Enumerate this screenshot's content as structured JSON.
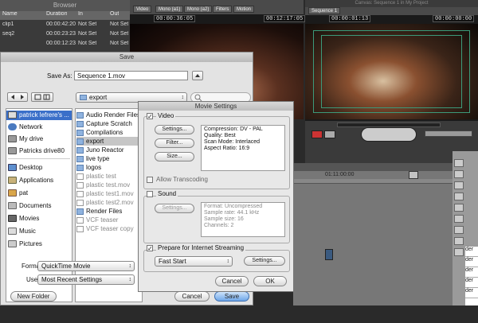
{
  "browser": {
    "title": "Browser",
    "columns": [
      "Name",
      "Duration",
      "In",
      "Out"
    ],
    "rows": [
      {
        "name": "clip1",
        "duration": "00:00:42:20",
        "in": "Not Set",
        "out": "Not Set"
      },
      {
        "name": "seq2",
        "duration": "00:00:23:23",
        "in": "Not Set",
        "out": "Not Set"
      },
      {
        "name": "",
        "duration": "00:00:12:23",
        "in": "Not Set",
        "out": "Not Set"
      }
    ]
  },
  "viewer": {
    "tabs": [
      "Video",
      "Mono (a1)",
      "Mono (a2)",
      "Filters",
      "Motion"
    ],
    "timecode_left": "00:00:36:05",
    "timecode_right": "00:12:17:05"
  },
  "canvas": {
    "title": "Canvas: Sequence 1 in My Project",
    "tab": "Sequence 1",
    "timecode_left": "00:00:01:13",
    "timecode_right": "00:00:00:00"
  },
  "timeline": {
    "ruler_time": "01:11:00:00",
    "track_labels": [
      "der",
      "der",
      "der",
      "der",
      "der"
    ]
  },
  "save_dialog": {
    "title": "Save",
    "save_as_label": "Save As:",
    "filename": "Sequence 1.mov",
    "location": "export",
    "sidebar": [
      {
        "label": "patrick lefrere's ...",
        "icon": "computer-icon",
        "selected": true
      },
      {
        "label": "Network",
        "icon": "globe-icon"
      },
      {
        "label": "My drive",
        "icon": "drive-icon"
      },
      {
        "label": "Patricks drive80",
        "icon": "drive-icon"
      },
      {
        "label": "Desktop",
        "icon": "desktop-icon"
      },
      {
        "label": "Applications",
        "icon": "applications-icon"
      },
      {
        "label": "pat",
        "icon": "home-icon"
      },
      {
        "label": "Documents",
        "icon": "folder-icon"
      },
      {
        "label": "Movies",
        "icon": "folder-icon"
      },
      {
        "label": "Music",
        "icon": "folder-icon"
      },
      {
        "label": "Pictures",
        "icon": "folder-icon"
      }
    ],
    "files": [
      {
        "label": "Audio Render Files",
        "type": "folder"
      },
      {
        "label": "Capture Scratch",
        "type": "folder"
      },
      {
        "label": "Compilations",
        "type": "folder"
      },
      {
        "label": "export",
        "type": "folder",
        "selected": true
      },
      {
        "label": "Juno Reactor",
        "type": "folder"
      },
      {
        "label": "live type",
        "type": "folder"
      },
      {
        "label": "logos",
        "type": "folder"
      },
      {
        "label": "plastic test",
        "type": "doc",
        "dim": true
      },
      {
        "label": "plastic test.mov",
        "type": "doc",
        "dim": true
      },
      {
        "label": "plastic test1.mov",
        "type": "doc",
        "dim": true
      },
      {
        "label": "plastic test2.mov",
        "type": "doc",
        "dim": true
      },
      {
        "label": "Render Files",
        "type": "folder"
      },
      {
        "label": "VCF teaser",
        "type": "doc",
        "dim": true
      },
      {
        "label": "VCF teaser copy",
        "type": "doc",
        "dim": true
      }
    ],
    "format_label": "Format:",
    "format_value": "QuickTime Movie",
    "use_label": "Use:",
    "use_value": "Most Recent Settings",
    "new_folder": "New Folder",
    "cancel": "Cancel",
    "save": "Save"
  },
  "movie_settings": {
    "title": "Movie Settings",
    "video_label": "Video",
    "settings_btn": "Settings...",
    "filter_btn": "Filter...",
    "size_btn": "Size...",
    "video_info": "Compression: DV - PAL\nQuality: Best\nScan Mode: Interlaced\nAspect Ratio: 16:9",
    "allow_transcoding": "Allow Transcoding",
    "sound_label": "Sound",
    "sound_settings_btn": "Settings...",
    "sound_info": "Format: Uncompressed\nSample rate: 44.1 kHz\nSample size: 16\nChannels: 2",
    "prepare_label": "Prepare for Internet Streaming",
    "streaming_value": "Fast Start",
    "streaming_settings_btn": "Settings...",
    "cancel": "Cancel",
    "ok": "OK"
  }
}
